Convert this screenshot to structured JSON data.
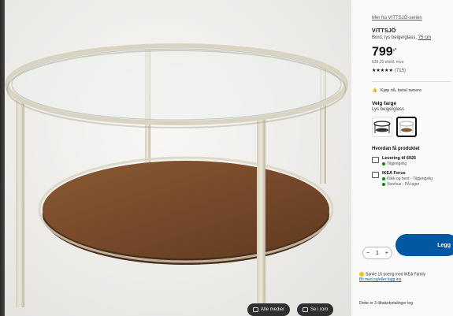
{
  "product": {
    "series_link": "Mer fra VITTSJÖ-serien",
    "name": "VITTSJÖ",
    "description": "Bord, lys beige/glass,",
    "size": "75 cm",
    "price_main": "799",
    "price_suffix": ",-",
    "price_ex_vat": "639,20 ekskl. mva",
    "rating_stars": "★★★★★",
    "rating_count": "(715)"
  },
  "klarna": {
    "label": "Kjøp nå, betal senere"
  },
  "color": {
    "title": "Velg farge",
    "value": "Lys beige/glass"
  },
  "delivery": {
    "title": "Hvordan få produktet",
    "shipping_label": "Levering til 6926",
    "shipping_status": "Tilgjengelig",
    "store_name": "IKEA Forus",
    "store_clickcollect": "Klikk og hent - Tilgjengelig",
    "store_stock": "Varehus - På lager"
  },
  "cart": {
    "minus": "−",
    "qty": "1",
    "plus": "+",
    "buy_label": "Legg"
  },
  "family": {
    "line1": "Samle 16 poeng med IKEA Family",
    "line2": "Bli med og/eller logg inn"
  },
  "footer_note": "Dette er 3 tilbakebetalinger tog",
  "media_pills": {
    "all_media": "Alle medier",
    "in_room": "Se i rom"
  },
  "colors": {
    "accent": "#0058a3",
    "stock_green": "#0a8a00",
    "family_yellow": "#f5c500"
  }
}
